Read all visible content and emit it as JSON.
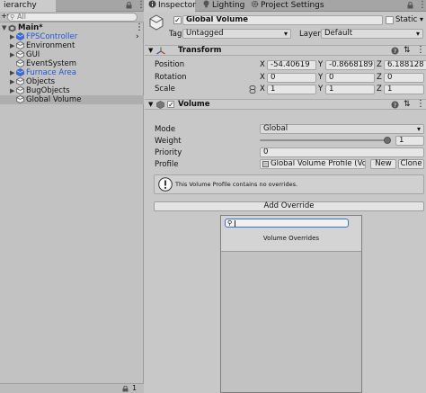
{
  "hierarchy": {
    "tab_label": "ierarchy",
    "search_placeholder": "All",
    "scene": "Main*",
    "items": [
      {
        "label": "FPSController",
        "prefab": true
      },
      {
        "label": "Environment",
        "prefab": false
      },
      {
        "label": "GUI",
        "prefab": false
      },
      {
        "label": "EventSystem",
        "prefab": false
      },
      {
        "label": "Furnace Area",
        "prefab": true
      },
      {
        "label": "Objects",
        "prefab": false
      },
      {
        "label": "BugObjects",
        "prefab": false
      },
      {
        "label": "Global Volume",
        "prefab": false
      }
    ],
    "footer_count": "1"
  },
  "tabs": {
    "inspector": "Inspector",
    "lighting": "Lighting",
    "project_settings": "Project Settings"
  },
  "object": {
    "name": "Global Volume",
    "static_label": "Static",
    "tag_label": "Tag",
    "tag_value": "Untagged",
    "layer_label": "Layer",
    "layer_value": "Default"
  },
  "transform": {
    "title": "Transform",
    "position_label": "Position",
    "rotation_label": "Rotation",
    "scale_label": "Scale",
    "position": {
      "x": "-54.40619",
      "y": "-0.8668189",
      "z": "6.188128"
    },
    "rotation": {
      "x": "0",
      "y": "0",
      "z": "0"
    },
    "scale": {
      "x": "1",
      "y": "1",
      "z": "1"
    }
  },
  "volume": {
    "title": "Volume",
    "mode_label": "Mode",
    "mode_value": "Global",
    "weight_label": "Weight",
    "weight_value": "1",
    "weight_fraction": 1.0,
    "priority_label": "Priority",
    "priority_value": "0",
    "profile_label": "Profile",
    "profile_value": "Global Volume Profile (Volume",
    "new_button": "New",
    "clone_button": "Clone",
    "info_message": "This Volume Profile contains no overrides.",
    "add_override_button": "Add Override"
  },
  "overrides_popup": {
    "title": "Volume Overrides",
    "search_value": ""
  },
  "axis_labels": {
    "x": "X",
    "y": "Y",
    "z": "Z"
  }
}
